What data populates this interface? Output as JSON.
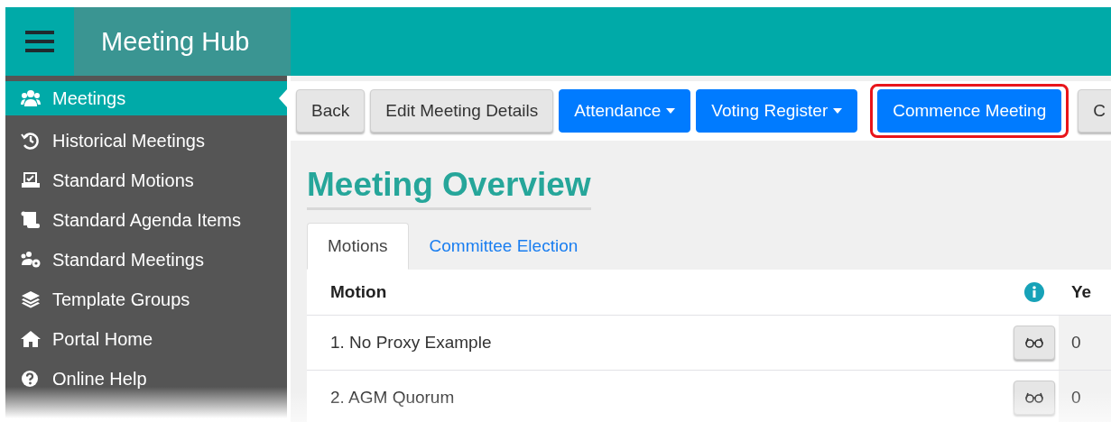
{
  "app": {
    "title": "Meeting Hub"
  },
  "sidebar": {
    "items": [
      {
        "label": "Meetings",
        "selected": true
      },
      {
        "label": "Historical Meetings",
        "selected": false
      },
      {
        "label": "Standard Motions",
        "selected": false
      },
      {
        "label": "Standard Agenda Items",
        "selected": false
      },
      {
        "label": "Standard Meetings",
        "selected": false
      },
      {
        "label": "Template Groups",
        "selected": false
      },
      {
        "label": "Portal Home",
        "selected": false
      },
      {
        "label": "Online Help",
        "selected": false
      }
    ]
  },
  "toolbar": {
    "buttons": [
      {
        "label": "Back",
        "kind": "light",
        "dropdown": false,
        "highlighted": false
      },
      {
        "label": "Edit Meeting Details",
        "kind": "light",
        "dropdown": false,
        "highlighted": false
      },
      {
        "label": "Attendance",
        "kind": "primary",
        "dropdown": true,
        "highlighted": false
      },
      {
        "label": "Voting Register",
        "kind": "primary",
        "dropdown": true,
        "highlighted": false
      },
      {
        "label": "Commence Meeting",
        "kind": "primary",
        "dropdown": false,
        "highlighted": true
      },
      {
        "label": "C",
        "kind": "light",
        "dropdown": false,
        "highlighted": false
      }
    ]
  },
  "page_title": "Meeting Overview",
  "tabs": [
    {
      "label": "Motions",
      "selected": true
    },
    {
      "label": "Committee Election",
      "selected": false
    }
  ],
  "table": {
    "columns": [
      "Motion",
      "Ye"
    ],
    "rows": [
      {
        "motion": "1. No Proxy Example",
        "column_2": "0"
      },
      {
        "motion": "2. AGM Quorum",
        "column_2": "0"
      }
    ]
  }
}
